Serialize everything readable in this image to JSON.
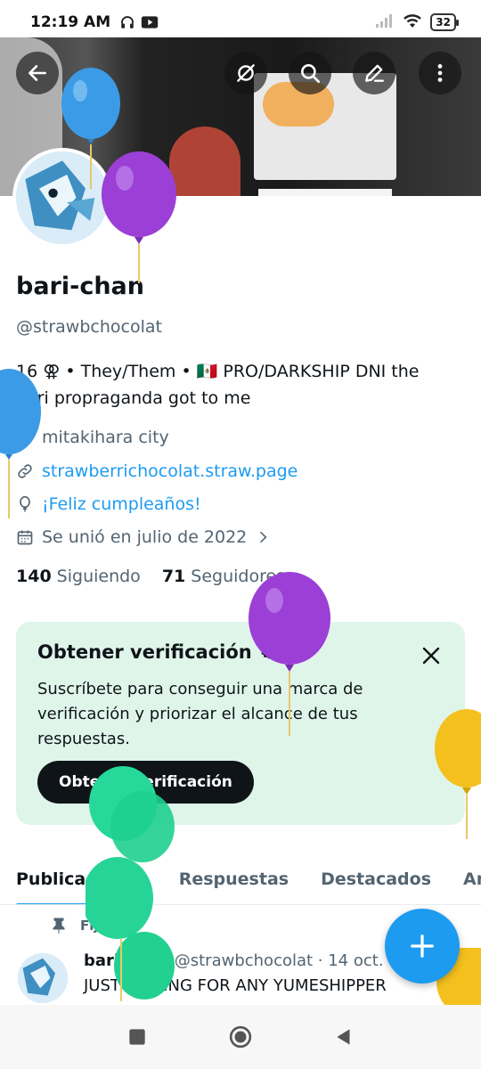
{
  "status_bar": {
    "time": "12:19 AM",
    "battery": "32"
  },
  "header": {
    "icons": [
      "back-arrow-icon",
      "hide-icon",
      "search-icon",
      "edit-icon",
      "more-options-icon"
    ]
  },
  "profile": {
    "name": "bari-chan",
    "handle": "@strawbchocolat",
    "bio_line1": "16 ⚢ • They/Them • 🇲🇽 PRO/DARKSHIP DNI the",
    "bio_line2": "bari propraganda got to me",
    "location": "mitakihara city",
    "website": "strawberrichocolat.straw.page",
    "birthday": "¡Feliz cumpleaños!",
    "joined": "Se unió en julio de 2022",
    "following_count": "140",
    "following_label": "Siguiendo",
    "followers_count": "71",
    "followers_label": "Seguidores"
  },
  "verification": {
    "title": "Obtener verificación",
    "body": "Suscríbete para conseguir una marca de verificación y priorizar el alcance de tus respuestas.",
    "button": "Obtener verificación"
  },
  "tabs": [
    {
      "label": "Publicaciones",
      "active": true
    },
    {
      "label": "Respuestas",
      "active": false
    },
    {
      "label": "Destacados",
      "active": false
    },
    {
      "label": "Artí",
      "active": false
    }
  ],
  "pinned_post": {
    "pinned_label": "Fijado",
    "author": "bari-chan",
    "meta": "@strawbchocolat · 14 oct.",
    "text": "JUST A THING FOR ANY YUMESHIPPER"
  },
  "colors": {
    "accent": "#1d9bf0",
    "verify_bg": "#dff5ea",
    "text": "#0f1419",
    "muted": "#536471"
  }
}
